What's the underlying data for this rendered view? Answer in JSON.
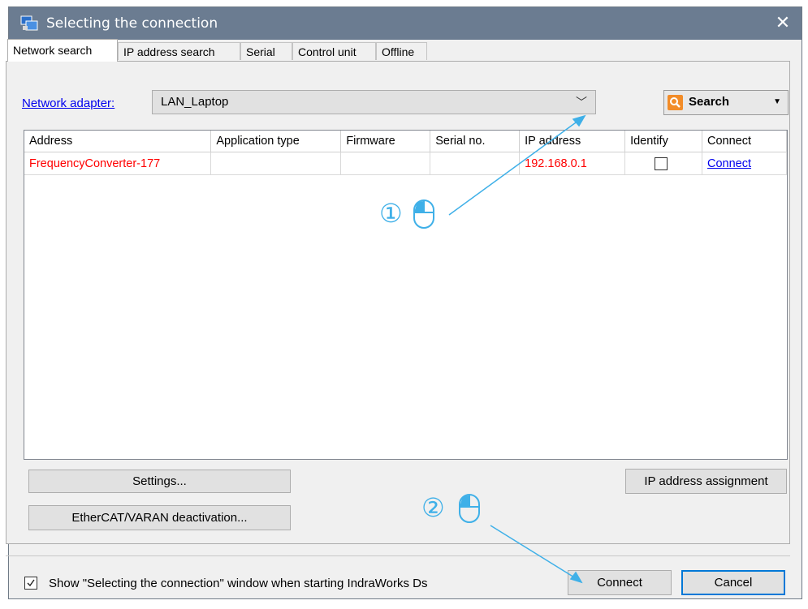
{
  "window": {
    "title": "Selecting the connection",
    "close_glyph": "✕"
  },
  "tabs": [
    {
      "label": "Network search",
      "active": true
    },
    {
      "label": "IP address search"
    },
    {
      "label": "Serial"
    },
    {
      "label": "Control unit"
    },
    {
      "label": "Offline"
    }
  ],
  "adapter": {
    "label": "Network adapter:",
    "value": "LAN_Laptop",
    "chevron": "﹀"
  },
  "search": {
    "label": "Search",
    "dropdown_glyph": "▼",
    "icon": "search-icon",
    "accent": "#f28c28"
  },
  "table": {
    "columns": [
      "Address",
      "Application type",
      "Firmware",
      "Serial no.",
      "IP address",
      "Identify",
      "Connect"
    ],
    "rows": [
      {
        "address": "FrequencyConverter-177",
        "application_type": "",
        "firmware": "",
        "serial_no": "",
        "ip_address": "192.168.0.1",
        "identify": false,
        "connect": "Connect"
      }
    ]
  },
  "buttons": {
    "settings": "Settings...",
    "ethercat": "EtherCAT/VARAN deactivation...",
    "ip_assignment": "IP address assignment",
    "connect": "Connect",
    "cancel": "Cancel"
  },
  "footer": {
    "show_window_label": "Show \"Selecting the connection\" window when starting IndraWorks Ds",
    "checked": true
  },
  "annotations": {
    "step1": "①",
    "step2": "②",
    "color": "#3fb0e8"
  }
}
